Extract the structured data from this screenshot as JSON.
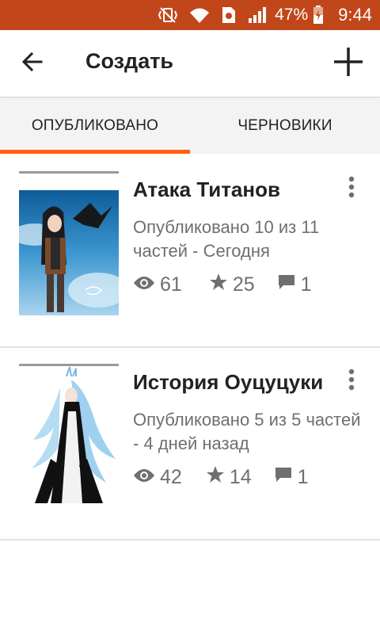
{
  "status_bar": {
    "battery_percent": "47%",
    "time": "9:44",
    "icons": [
      "vibrate-icon",
      "wifi-icon",
      "sim-icon",
      "signal-icon",
      "battery-charging-icon"
    ]
  },
  "app_bar": {
    "title": "Создать",
    "back_icon": "arrow-back-icon",
    "add_icon": "plus-icon"
  },
  "tabs": [
    {
      "label": "ОПУБЛИКОВАНО",
      "active": true
    },
    {
      "label": "ЧЕРНОВИКИ",
      "active": false
    }
  ],
  "colors": {
    "status_bar": "#c1471a",
    "tab_indicator": "#ff5f0e",
    "text_primary": "#222222",
    "text_secondary": "#6f6f6f"
  },
  "stories": [
    {
      "title": "Атака Титанов",
      "meta": "Опубликовано 10 из 11 частей - Сегодня",
      "views": "61",
      "votes": "25",
      "comments": "1"
    },
    {
      "title": "История Оуцуцуки",
      "meta": "Опубликовано 5 из 5 частей - 4 дней назад",
      "views": "42",
      "votes": "14",
      "comments": "1"
    }
  ]
}
